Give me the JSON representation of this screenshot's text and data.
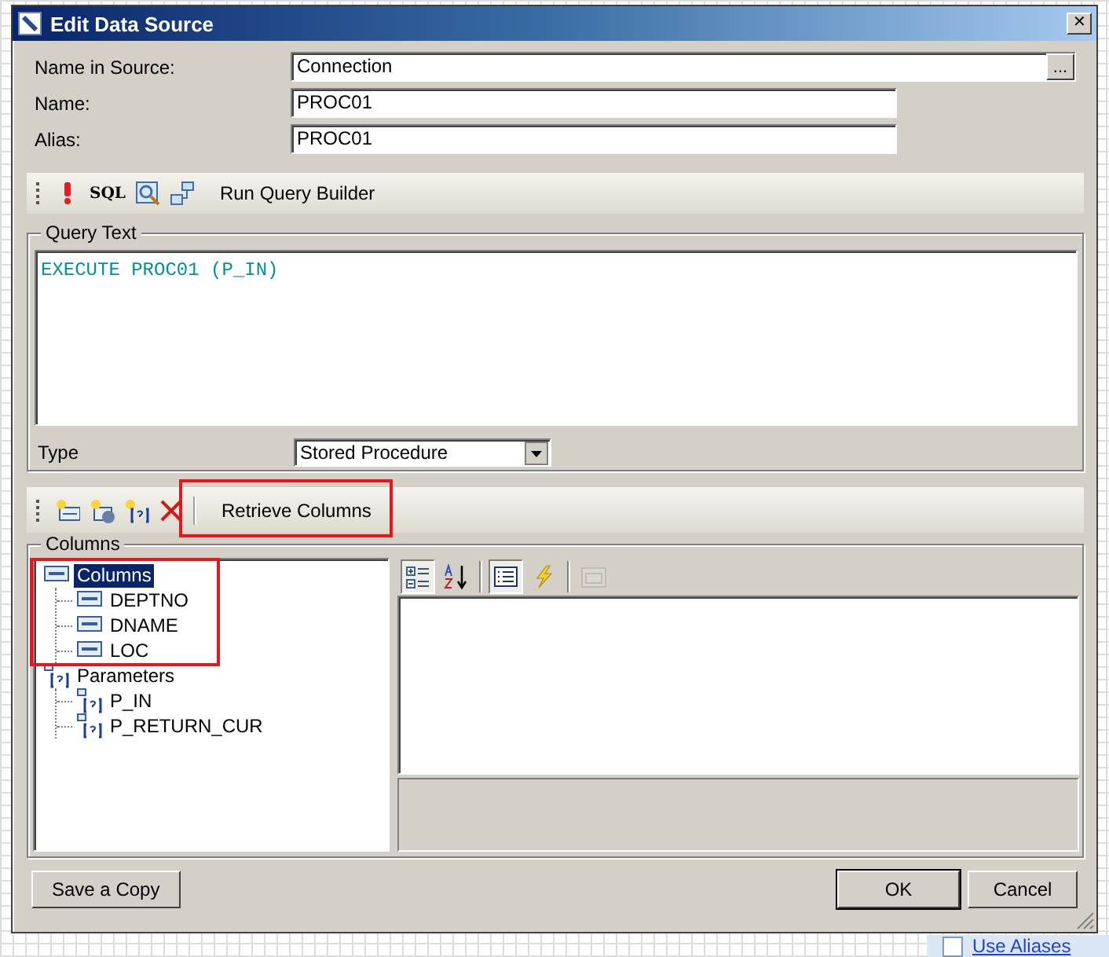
{
  "background": {
    "checkbox_label": "Use Aliases",
    "checked": false
  },
  "window": {
    "title": "Edit Data Source",
    "close": "✕"
  },
  "fields": [
    {
      "label": "Name in Source:",
      "value": "Connection",
      "kind": "browse",
      "browse_label": "..."
    },
    {
      "label": "Name:",
      "value": "PROC01",
      "kind": "text"
    },
    {
      "label": "Alias:",
      "value": "PROC01",
      "kind": "text"
    }
  ],
  "query_toolbar": {
    "tools": [
      {
        "kind": "execute"
      },
      {
        "kind": "sql",
        "label": "SQL"
      },
      {
        "kind": "preview"
      },
      {
        "kind": "builder"
      }
    ],
    "run_label": "Run Query Builder"
  },
  "query_text": {
    "label": "Query Text",
    "value": "EXECUTE PROC01 (P_IN)"
  },
  "type": {
    "label": "Type",
    "value": "Stored Procedure"
  },
  "columns_toolbar": {
    "tools": [
      {
        "kind": "add-column"
      },
      {
        "kind": "add-calculated"
      },
      {
        "kind": "add-parameter"
      },
      {
        "kind": "delete"
      }
    ],
    "retrieve_label": "Retrieve Columns"
  },
  "columns": {
    "label": "Columns",
    "tree": [
      {
        "label": "Columns",
        "kind": "columns",
        "selected": true,
        "children": [
          {
            "label": "DEPTNO",
            "kind": "column",
            "selected": false
          },
          {
            "label": "DNAME",
            "kind": "column",
            "selected": false
          },
          {
            "label": "LOC",
            "kind": "column",
            "selected": false
          }
        ]
      },
      {
        "label": "Parameters",
        "kind": "parameters",
        "selected": false,
        "children": [
          {
            "label": "P_IN",
            "kind": "parameter",
            "selected": false
          },
          {
            "label": "P_RETURN_CUR",
            "kind": "parameter",
            "selected": false
          }
        ]
      }
    ],
    "grid_tools": [
      {
        "kind": "categorized",
        "selected": true,
        "disabled": false
      },
      {
        "kind": "alphabetical",
        "selected": false,
        "disabled": false
      },
      {
        "kind": "properties",
        "selected": true,
        "disabled": false
      },
      {
        "kind": "events",
        "selected": false,
        "disabled": false
      },
      {
        "kind": "pages",
        "selected": false,
        "disabled": true
      }
    ]
  },
  "buttons": [
    {
      "label": "Save a Copy",
      "kind": "left",
      "default": false
    },
    {
      "label": "OK",
      "kind": "right",
      "default": true
    },
    {
      "label": "Cancel",
      "kind": "right",
      "default": false
    }
  ]
}
